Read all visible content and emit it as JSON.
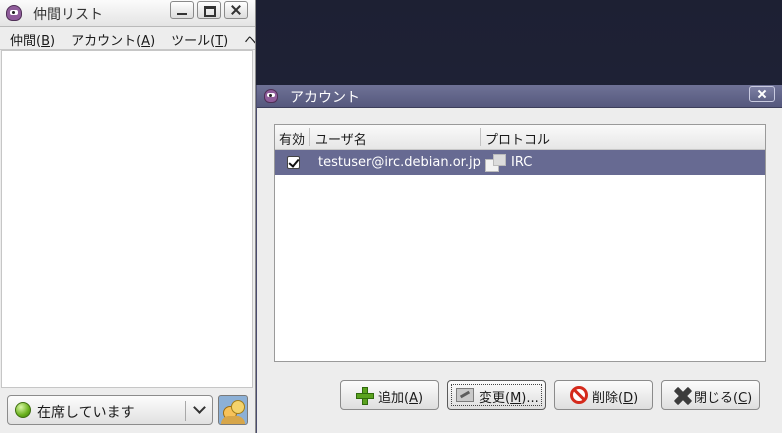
{
  "buddy_window": {
    "title": "仲間リスト",
    "menu": [
      {
        "text": "仲間(",
        "key": "B",
        "end": ")"
      },
      {
        "text": "アカウント(",
        "key": "A",
        "end": ")"
      },
      {
        "text": "ツール(",
        "key": "T",
        "end": ")"
      },
      {
        "text": "ヘ",
        "key": "",
        "end": ""
      }
    ],
    "status": {
      "label": "在席しています",
      "color": "#69b01b"
    }
  },
  "accounts_dialog": {
    "title": "アカウント",
    "columns": {
      "enabled": "有効",
      "username": "ユーザ名",
      "protocol": "プロトコル"
    },
    "rows": [
      {
        "enabled": true,
        "username": "testuser@irc.debian.or.jp",
        "protocol": "IRC"
      }
    ],
    "buttons": {
      "add": {
        "text": "追加(",
        "key": "A",
        "end": ")"
      },
      "edit": {
        "text": "変更(",
        "key": "M",
        "end": ")..."
      },
      "delete": {
        "text": "削除(",
        "key": "D",
        "end": ")"
      },
      "close": {
        "text": "閉じる(",
        "key": "C",
        "end": ")"
      }
    },
    "selection_color": "#676a92"
  },
  "icons": [
    "pidgin-app-icon",
    "minimize-icon",
    "maximize-icon",
    "close-icon",
    "available-status-icon",
    "chevron-down-icon",
    "buddy-avatar-icon",
    "checkbox-checked-icon",
    "irc-protocol-icon",
    "add-icon",
    "edit-icon",
    "delete-icon",
    "close-x-icon"
  ]
}
